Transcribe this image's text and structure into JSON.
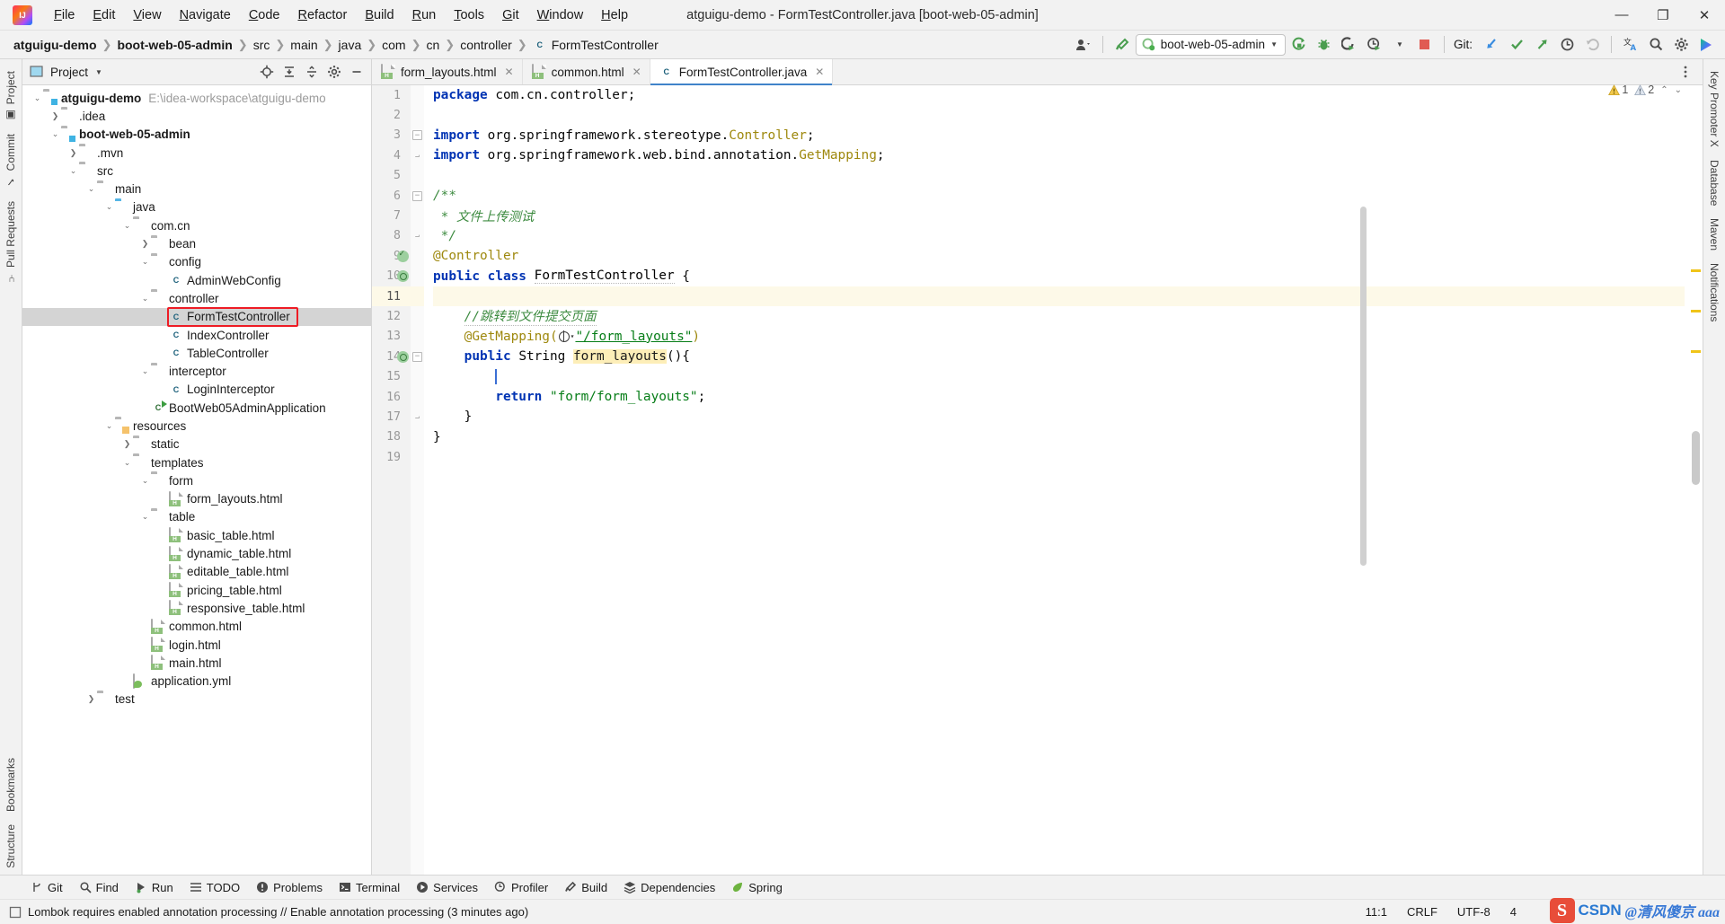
{
  "window": {
    "title": "atguigu-demo - FormTestController.java [boot-web-05-admin]",
    "minimize": "—",
    "maximize": "❐",
    "close": "✕",
    "logo_text": "IJ"
  },
  "menu": [
    {
      "label": "File"
    },
    {
      "label": "Edit"
    },
    {
      "label": "View"
    },
    {
      "label": "Navigate"
    },
    {
      "label": "Code"
    },
    {
      "label": "Refactor"
    },
    {
      "label": "Build"
    },
    {
      "label": "Run"
    },
    {
      "label": "Tools"
    },
    {
      "label": "Git"
    },
    {
      "label": "Window"
    },
    {
      "label": "Help"
    }
  ],
  "breadcrumbs": [
    {
      "label": "atguigu-demo",
      "bold": true
    },
    {
      "label": "boot-web-05-admin",
      "bold": true
    },
    {
      "label": "src",
      "bold": false
    },
    {
      "label": "main",
      "bold": false
    },
    {
      "label": "java",
      "bold": false
    },
    {
      "label": "com",
      "bold": false
    },
    {
      "label": "cn",
      "bold": false
    },
    {
      "label": "controller",
      "bold": false
    },
    {
      "label": "FormTestController",
      "bold": false,
      "icon": "class-icon"
    }
  ],
  "toolbar": {
    "run_config": "boot-web-05-admin",
    "git_label": "Git:",
    "icons": [
      "user-avatar-icon",
      "hammer-build-icon",
      "run-icon",
      "debug-icon",
      "run-coverage-icon",
      "profiler-icon",
      "stop-icon",
      "git-update-icon",
      "git-commit-icon",
      "git-push-icon",
      "git-history-icon",
      "git-rollback-icon",
      "translate-icon",
      "search-everywhere-icon",
      "settings-gear-icon",
      "ide-feature-icon"
    ]
  },
  "left_rail": [
    "Project",
    "Commit",
    "Pull Requests",
    "Bookmarks",
    "Structure"
  ],
  "right_rail": [
    "Key Promoter X",
    "Database",
    "Maven",
    "Notifications"
  ],
  "project_panel": {
    "title": "Project",
    "actions": [
      "locate-icon",
      "expand-all-icon",
      "collapse-all-icon",
      "settings-icon",
      "hide-icon"
    ],
    "tree": [
      {
        "depth": 0,
        "twist": "v",
        "icon": "module-folder",
        "label": "atguigu-demo",
        "bold": true,
        "path": "E:\\idea-workspace\\atguigu-demo"
      },
      {
        "depth": 1,
        "twist": ">",
        "icon": "folder",
        "label": ".idea",
        "bold": false
      },
      {
        "depth": 1,
        "twist": "v",
        "icon": "module-folder",
        "label": "boot-web-05-admin",
        "bold": true
      },
      {
        "depth": 2,
        "twist": ">",
        "icon": "folder",
        "label": ".mvn",
        "bold": false
      },
      {
        "depth": 2,
        "twist": "v",
        "icon": "folder",
        "label": "src",
        "bold": false
      },
      {
        "depth": 3,
        "twist": "v",
        "icon": "folder",
        "label": "main",
        "bold": false
      },
      {
        "depth": 4,
        "twist": "v",
        "icon": "source-folder",
        "label": "java",
        "bold": false
      },
      {
        "depth": 5,
        "twist": "v",
        "icon": "package",
        "label": "com.cn",
        "bold": false
      },
      {
        "depth": 6,
        "twist": ">",
        "icon": "package",
        "label": "bean",
        "bold": false
      },
      {
        "depth": 6,
        "twist": "v",
        "icon": "package",
        "label": "config",
        "bold": false
      },
      {
        "depth": 7,
        "twist": "",
        "icon": "class",
        "label": "AdminWebConfig",
        "bold": false
      },
      {
        "depth": 6,
        "twist": "v",
        "icon": "package",
        "label": "controller",
        "bold": false
      },
      {
        "depth": 7,
        "twist": "",
        "icon": "class",
        "label": "FormTestController",
        "bold": false,
        "selected": true,
        "highlight": true
      },
      {
        "depth": 7,
        "twist": "",
        "icon": "class",
        "label": "IndexController",
        "bold": false
      },
      {
        "depth": 7,
        "twist": "",
        "icon": "class",
        "label": "TableController",
        "bold": false
      },
      {
        "depth": 6,
        "twist": "v",
        "icon": "package",
        "label": "interceptor",
        "bold": false
      },
      {
        "depth": 7,
        "twist": "",
        "icon": "class",
        "label": "LoginInterceptor",
        "bold": false
      },
      {
        "depth": 6,
        "twist": "",
        "icon": "class-run",
        "label": "BootWeb05AdminApplication",
        "bold": false
      },
      {
        "depth": 4,
        "twist": "v",
        "icon": "resource-folder",
        "label": "resources",
        "bold": false
      },
      {
        "depth": 5,
        "twist": ">",
        "icon": "folder",
        "label": "static",
        "bold": false
      },
      {
        "depth": 5,
        "twist": "v",
        "icon": "folder",
        "label": "templates",
        "bold": false
      },
      {
        "depth": 6,
        "twist": "v",
        "icon": "folder",
        "label": "form",
        "bold": false
      },
      {
        "depth": 7,
        "twist": "",
        "icon": "html",
        "label": "form_layouts.html",
        "bold": false
      },
      {
        "depth": 6,
        "twist": "v",
        "icon": "folder",
        "label": "table",
        "bold": false
      },
      {
        "depth": 7,
        "twist": "",
        "icon": "html",
        "label": "basic_table.html",
        "bold": false
      },
      {
        "depth": 7,
        "twist": "",
        "icon": "html",
        "label": "dynamic_table.html",
        "bold": false
      },
      {
        "depth": 7,
        "twist": "",
        "icon": "html",
        "label": "editable_table.html",
        "bold": false
      },
      {
        "depth": 7,
        "twist": "",
        "icon": "html",
        "label": "pricing_table.html",
        "bold": false
      },
      {
        "depth": 7,
        "twist": "",
        "icon": "html",
        "label": "responsive_table.html",
        "bold": false
      },
      {
        "depth": 6,
        "twist": "",
        "icon": "html",
        "label": "common.html",
        "bold": false
      },
      {
        "depth": 6,
        "twist": "",
        "icon": "html",
        "label": "login.html",
        "bold": false
      },
      {
        "depth": 6,
        "twist": "",
        "icon": "html",
        "label": "main.html",
        "bold": false
      },
      {
        "depth": 5,
        "twist": "",
        "icon": "yml",
        "label": "application.yml",
        "bold": false
      },
      {
        "depth": 3,
        "twist": ">",
        "icon": "folder",
        "label": "test",
        "bold": false
      }
    ]
  },
  "editor": {
    "tabs": [
      {
        "label": "form_layouts.html",
        "icon": "html-icon",
        "active": false,
        "close": "✕"
      },
      {
        "label": "common.html",
        "icon": "html-icon",
        "active": false,
        "close": "✕"
      },
      {
        "label": "FormTestController.java",
        "icon": "class-icon",
        "active": true,
        "close": "✕"
      }
    ],
    "inspections": {
      "warning_count": "1",
      "weak_warning_count": "2"
    },
    "lines": [
      {
        "n": "1",
        "cur": false,
        "gutter": "",
        "fold": ""
      },
      {
        "n": "2",
        "cur": false,
        "gutter": "",
        "fold": ""
      },
      {
        "n": "3",
        "cur": false,
        "gutter": "",
        "fold": "minus"
      },
      {
        "n": "4",
        "cur": false,
        "gutter": "",
        "fold": "end"
      },
      {
        "n": "5",
        "cur": false,
        "gutter": "",
        "fold": ""
      },
      {
        "n": "6",
        "cur": false,
        "gutter": "",
        "fold": "minus"
      },
      {
        "n": "7",
        "cur": false,
        "gutter": "",
        "fold": ""
      },
      {
        "n": "8",
        "cur": false,
        "gutter": "",
        "fold": "end"
      },
      {
        "n": "9",
        "cur": false,
        "gutter": "bean-check",
        "fold": ""
      },
      {
        "n": "10",
        "cur": false,
        "gutter": "bean",
        "fold": ""
      },
      {
        "n": "11",
        "cur": true,
        "gutter": "",
        "fold": ""
      },
      {
        "n": "12",
        "cur": false,
        "gutter": "",
        "fold": ""
      },
      {
        "n": "13",
        "cur": false,
        "gutter": "",
        "fold": ""
      },
      {
        "n": "14",
        "cur": false,
        "gutter": "bean",
        "fold": "minus"
      },
      {
        "n": "15",
        "cur": false,
        "gutter": "",
        "fold": ""
      },
      {
        "n": "16",
        "cur": false,
        "gutter": "",
        "fold": ""
      },
      {
        "n": "17",
        "cur": false,
        "gutter": "",
        "fold": "end"
      },
      {
        "n": "18",
        "cur": false,
        "gutter": "",
        "fold": ""
      },
      {
        "n": "19",
        "cur": false,
        "gutter": "",
        "fold": ""
      }
    ],
    "code_text": {
      "l1_kw": "package",
      "l1_rest": " com.cn.controller;",
      "l3_kw": "import",
      "l3_pkg": " org.springframework.stereotype.",
      "l3_cls": "Controller",
      "l3_end": ";",
      "l4_kw": "import",
      "l4_pkg": " org.springframework.web.bind.annotation.",
      "l4_cls": "GetMapping",
      "l4_end": ";",
      "l6": "/**",
      "l7": " * 文件上传测试",
      "l8": " */",
      "l9": "@Controller",
      "l10_kw1": "public",
      "l10_kw2": "class",
      "l10_name": "FormTestController",
      "l10_brace": "{",
      "l12": "//跳转到文件提交页面",
      "l13_anno": "@GetMapping(",
      "l13_str": "\"/form_layouts\"",
      "l13_end": ")",
      "l14_kw": "public",
      "l14_type": "String",
      "l14_name": "form_layouts",
      "l14_end": "(){",
      "l16_kw": "return",
      "l16_str": "\"form/form_layouts\"",
      "l16_end": ";",
      "l17": "}",
      "l18": "}"
    }
  },
  "bottom_toolwindows": [
    {
      "label": "Git",
      "icon": "git-branch-icon"
    },
    {
      "label": "Find",
      "icon": "search-icon"
    },
    {
      "label": "Run",
      "icon": "run-icon"
    },
    {
      "label": "TODO",
      "icon": "todo-list-icon"
    },
    {
      "label": "Problems",
      "icon": "problems-icon"
    },
    {
      "label": "Terminal",
      "icon": "terminal-icon"
    },
    {
      "label": "Services",
      "icon": "services-icon"
    },
    {
      "label": "Profiler",
      "icon": "profiler-icon"
    },
    {
      "label": "Build",
      "icon": "build-hammer-icon"
    },
    {
      "label": "Dependencies",
      "icon": "dependencies-icon"
    },
    {
      "label": "Spring",
      "icon": "spring-leaf-icon"
    }
  ],
  "statusbar": {
    "message": "Lombok requires enabled annotation processing // Enable annotation processing (3 minutes ago)",
    "message_icon": "event-log-icon",
    "caret": "11:1",
    "line_separator": "CRLF",
    "encoding": "UTF-8",
    "indent": "4"
  },
  "watermark": {
    "logo": "S",
    "csdn": "CSDN",
    "handle": "@清风傻京 aaa"
  },
  "colors": {
    "accent_blue": "#4083c9",
    "keyword_blue": "#0033b3",
    "string_green": "#067d17",
    "comment_gray": "#8c8c8c",
    "doc_green": "#3d8b40",
    "annotation_gold": "#9e880d",
    "selection_red": "#ee1c25",
    "current_line": "#fdf9e8",
    "tree_selection": "#d4d4d4"
  }
}
